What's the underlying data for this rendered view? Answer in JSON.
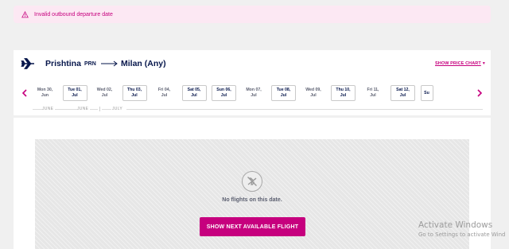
{
  "alert": {
    "message": "Invalid outbound departure date",
    "icon": "warning-icon"
  },
  "route": {
    "origin_city": "Prishtina",
    "origin_code": "PRN",
    "destination": "Milan (Any)",
    "price_chart_link": "SHOW PRICE CHART",
    "price_chart_symbol": "▼"
  },
  "date_strip": {
    "dates": [
      {
        "line1": "Mon 30,",
        "line2": "Jun",
        "available": false
      },
      {
        "line1": "Tue 01,",
        "line2": "Jul",
        "available": true
      },
      {
        "line1": "Wed 02,",
        "line2": "Jul",
        "available": false
      },
      {
        "line1": "Thu 03,",
        "line2": "Jul",
        "available": true
      },
      {
        "line1": "Fri 04,",
        "line2": "Jul",
        "available": false
      },
      {
        "line1": "Sat 05,",
        "line2": "Jul",
        "available": true
      },
      {
        "line1": "Sun 06,",
        "line2": "Jul",
        "available": true
      },
      {
        "line1": "Mon 07,",
        "line2": "Jul",
        "available": false
      },
      {
        "line1": "Tue 08,",
        "line2": "Jul",
        "available": true
      },
      {
        "line1": "Wed 09,",
        "line2": "Jul",
        "available": false
      },
      {
        "line1": "Thu 10,",
        "line2": "Jul",
        "available": true
      },
      {
        "line1": "Fri 11,",
        "line2": "Jul",
        "available": false
      },
      {
        "line1": "Sat 12,",
        "line2": "Jul",
        "available": true
      },
      {
        "line1": "Su",
        "line2": "",
        "available": true
      }
    ],
    "months": [
      "JUNE",
      "JUNE",
      "JULY"
    ]
  },
  "results": {
    "empty_message": "No flights on this date.",
    "next_button": "SHOW NEXT AVAILABLE FLIGHT"
  },
  "watermark": {
    "line1": "Activate Windows",
    "line2": "Go to Settings to activate Wind"
  },
  "colors": {
    "accent": "#c6007e",
    "navy": "#06164b",
    "alert_bg": "#fce8f3"
  }
}
